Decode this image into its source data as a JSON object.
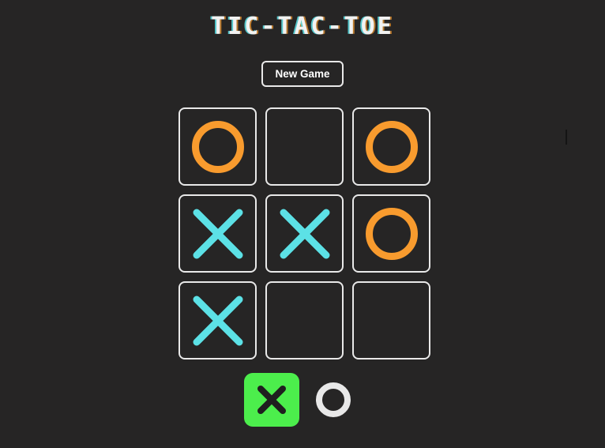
{
  "app": {
    "title": "TIC-TAC-TOE"
  },
  "toolbar": {
    "new_game_label": "New Game"
  },
  "colors": {
    "background": "#262525",
    "cell_border": "#e9e9e9",
    "o_mark": "#f89b2e",
    "x_mark": "#5ce1e6",
    "active_turn_bg": "#4cee4c",
    "active_turn_mark": "#1f1f1f",
    "inactive_turn_mark": "#e8e8e8",
    "title_text": "#f2f2f2"
  },
  "board": {
    "rows": 3,
    "columns": 3,
    "cells": [
      {
        "index": 0,
        "row": 0,
        "col": 0,
        "mark": "O",
        "name": "board-cell-0"
      },
      {
        "index": 1,
        "row": 0,
        "col": 1,
        "mark": "",
        "name": "board-cell-1"
      },
      {
        "index": 2,
        "row": 0,
        "col": 2,
        "mark": "O",
        "name": "board-cell-2"
      },
      {
        "index": 3,
        "row": 1,
        "col": 0,
        "mark": "X",
        "name": "board-cell-3"
      },
      {
        "index": 4,
        "row": 1,
        "col": 1,
        "mark": "X",
        "name": "board-cell-4"
      },
      {
        "index": 5,
        "row": 1,
        "col": 2,
        "mark": "O",
        "name": "board-cell-5"
      },
      {
        "index": 6,
        "row": 2,
        "col": 0,
        "mark": "X",
        "name": "board-cell-6"
      },
      {
        "index": 7,
        "row": 2,
        "col": 1,
        "mark": "",
        "name": "board-cell-7"
      },
      {
        "index": 8,
        "row": 2,
        "col": 2,
        "mark": "",
        "name": "board-cell-8"
      }
    ]
  },
  "turn_indicator": {
    "current_player": "X",
    "players": [
      {
        "mark": "X",
        "active": true
      },
      {
        "mark": "O",
        "active": false
      }
    ]
  },
  "cursor": {
    "type": "text-caret",
    "visible": true,
    "in_cell_index": 2
  }
}
